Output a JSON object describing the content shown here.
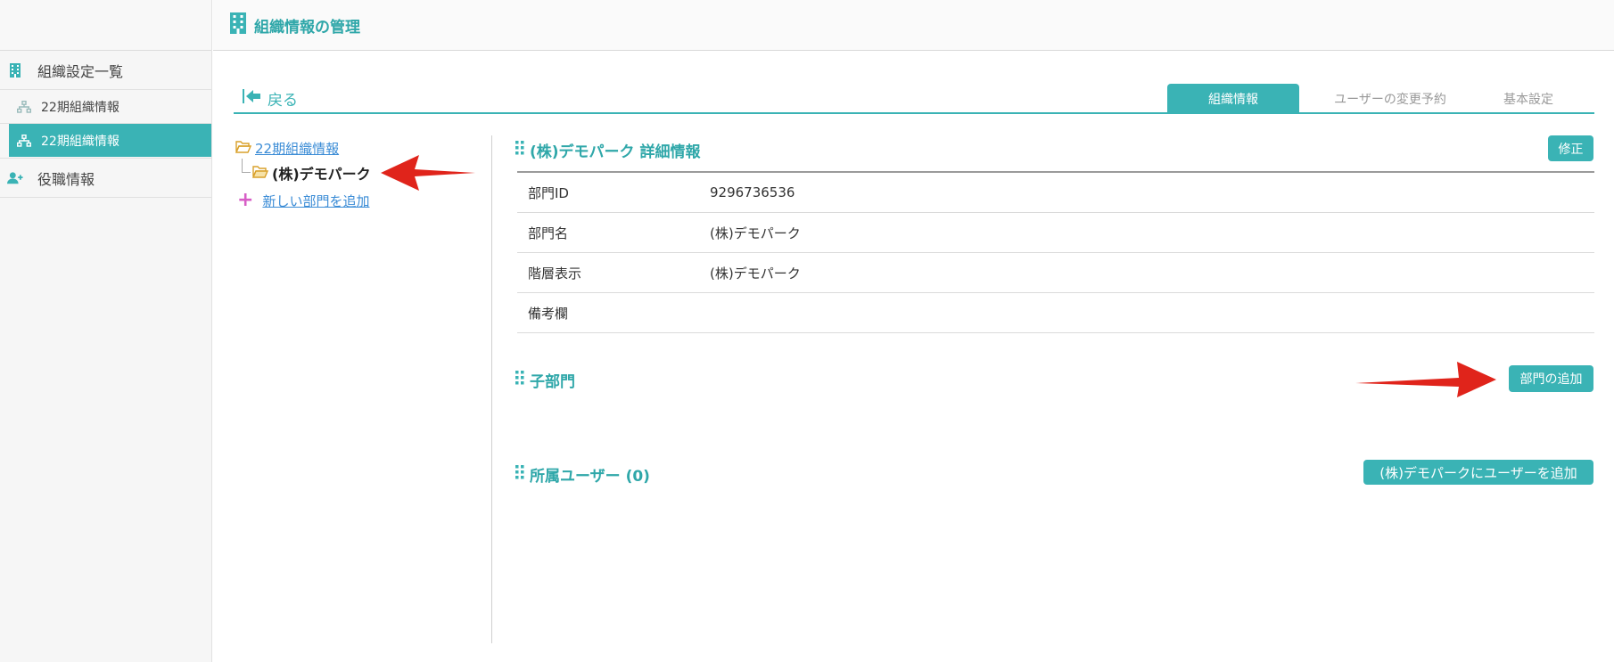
{
  "header": {
    "title": "組織情報の管理"
  },
  "sidebar": {
    "section_org": "組織設定一覧",
    "items": [
      {
        "label": "22期組織情報"
      },
      {
        "label": "22期組織情報"
      }
    ],
    "section_roles": "役職情報"
  },
  "nav": {
    "back": "戻る",
    "tabs": [
      {
        "label": "組織情報"
      },
      {
        "label": "ユーザーの変更予約"
      },
      {
        "label": "基本設定"
      }
    ]
  },
  "tree": {
    "root": "22期組織情報",
    "child": "(株)デモパーク",
    "add_department": "新しい部門を追加"
  },
  "detail": {
    "title": "(株)デモパーク 詳細情報",
    "edit_button": "修正",
    "rows": [
      {
        "key": "部門ID",
        "value": "9296736536"
      },
      {
        "key": "部門名",
        "value": "(株)デモパーク"
      },
      {
        "key": "階層表示",
        "value": "(株)デモパーク"
      },
      {
        "key": "備考欄",
        "value": ""
      }
    ]
  },
  "children": {
    "title": "子部門",
    "add_button": "部門の追加"
  },
  "members": {
    "title": "所属ユーザー (0)",
    "add_button": "(株)デモパークにユーザーを追加"
  },
  "colors": {
    "accent": "#3ab3b5",
    "link": "#3b8cd6",
    "annotation": "#e0241b"
  }
}
